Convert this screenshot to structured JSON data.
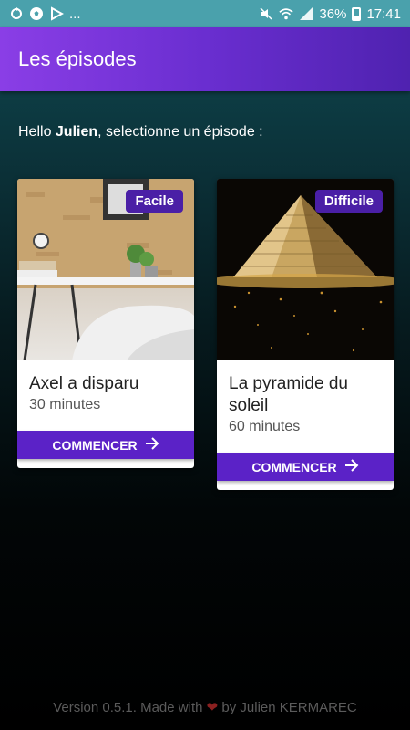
{
  "status_bar": {
    "left_icons": [
      "sync-icon",
      "soccer-icon",
      "play-store-icon"
    ],
    "more": "...",
    "battery_percent": "36%",
    "time": "17:41",
    "battery_level": 0.36
  },
  "app_bar": {
    "title": "Les épisodes"
  },
  "greeting": {
    "prefix": "Hello ",
    "name": "Julien",
    "suffix": ", selectionne un épisode :"
  },
  "episodes": [
    {
      "title": "Axel a disparu",
      "duration": "30 minutes",
      "difficulty": "Facile",
      "button": "COMMENCER"
    },
    {
      "title": "La pyramide du soleil",
      "duration": "60 minutes",
      "difficulty": "Difficile",
      "button": "COMMENCER"
    }
  ],
  "footer": {
    "prefix": "Version 0.5.1. Made with ",
    "heart": "❤",
    "suffix": " by Julien KERMAREC"
  },
  "colors": {
    "app_bar_start": "#8a3ee6",
    "app_bar_end": "#4f22b0",
    "badge": "#4a1fa6",
    "button": "#5b22c7",
    "status_bar": "#4aa1ac"
  }
}
